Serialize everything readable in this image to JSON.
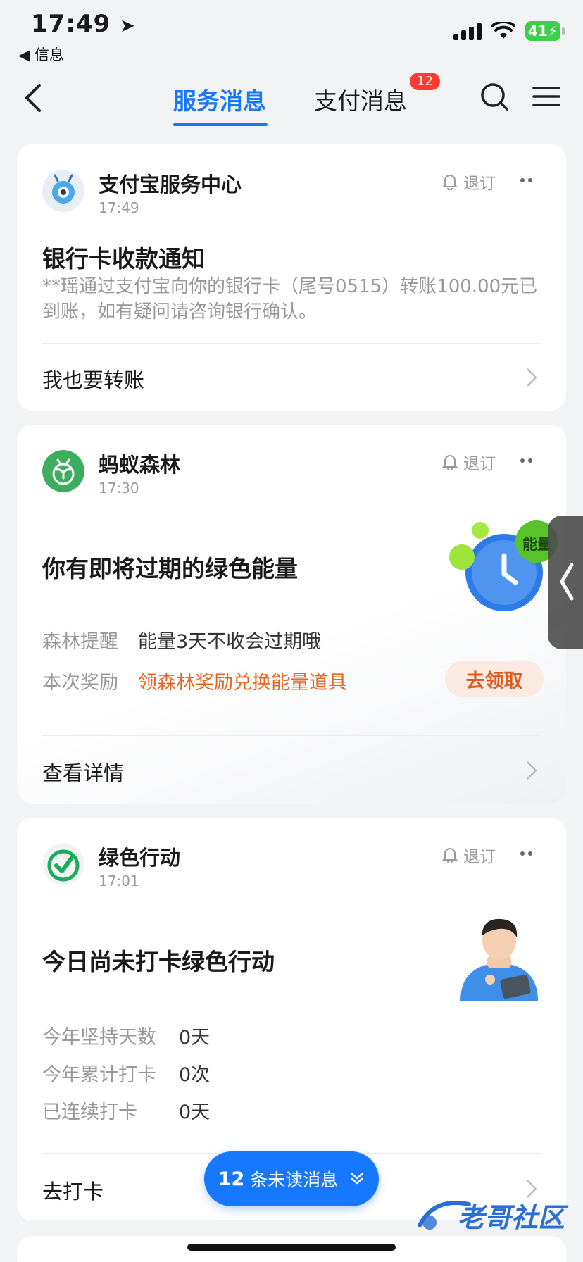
{
  "status_bar": {
    "time": "17:49",
    "back_app": "信息",
    "battery": "41"
  },
  "header": {
    "tabs": [
      {
        "label": "服务消息",
        "active": true
      },
      {
        "label": "支付消息",
        "active": false,
        "badge": "12"
      }
    ]
  },
  "cards": [
    {
      "source": "支付宝服务中心",
      "time": "17:49",
      "unsubscribe": "退订",
      "title": "银行卡收款通知",
      "body": "**瑶通过支付宝向你的银行卡（尾号0515）转账100.00元已到账，如有疑问请咨询银行确认。",
      "footer": "我也要转账"
    },
    {
      "source": "蚂蚁森林",
      "time": "17:30",
      "unsubscribe": "退订",
      "title": "你有即将过期的绿色能量",
      "rows": [
        {
          "label": "森林提醒",
          "value": "能量3天不收会过期哦"
        },
        {
          "label": "本次奖励",
          "value": "领森林奖励兑换能量道具"
        }
      ],
      "image_label": "能量",
      "action": "去领取",
      "footer": "查看详情"
    },
    {
      "source": "绿色行动",
      "time": "17:01",
      "unsubscribe": "退订",
      "title": "今日尚未打卡绿色行动",
      "rows": [
        {
          "label": "今年坚持天数",
          "value": "0天"
        },
        {
          "label": "今年累计打卡",
          "value": "0次"
        },
        {
          "label": "已连续打卡",
          "value": "0天"
        }
      ],
      "footer": "去打卡"
    }
  ],
  "unread": {
    "count": "12",
    "text": "条未读消息"
  },
  "watermark": "老哥社区",
  "colors": {
    "accent": "#1677ff",
    "badge": "#ff3b30",
    "reward": "#e05a1c",
    "forest": "#3dae5f"
  }
}
